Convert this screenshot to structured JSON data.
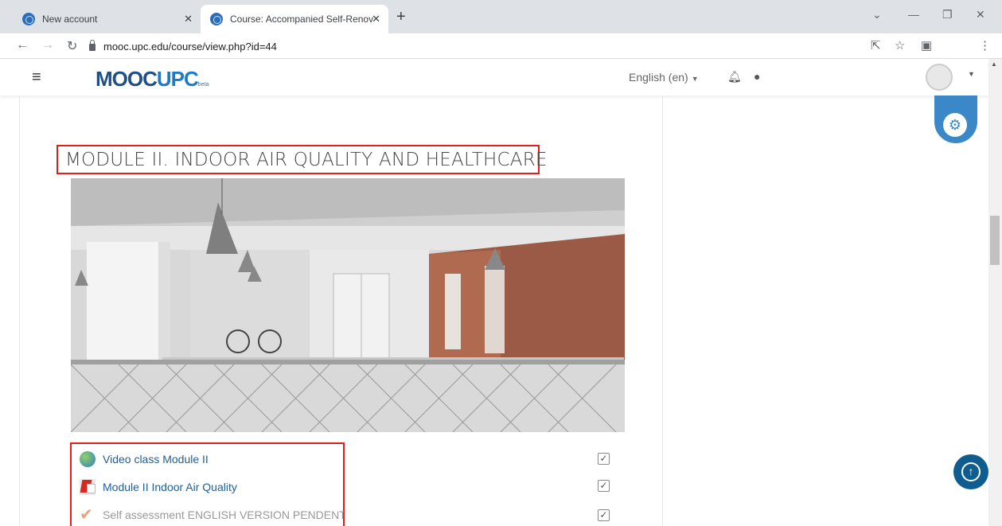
{
  "browser": {
    "tabs": [
      {
        "title": "New account"
      },
      {
        "title": "Course: Accompanied Self-Renov"
      }
    ],
    "url": "mooc.upc.edu/course/view.php?id=44"
  },
  "site": {
    "logo_main": "MOOC",
    "logo_accent": "UPC",
    "logo_beta": "beta",
    "language": "English (en)"
  },
  "module": {
    "title": "MODULE II. INDOOR AIR QUALITY AND HEALTHCARE",
    "activities": [
      {
        "label": "Video class Module II",
        "icon": "video-icon",
        "completed": true,
        "dimmed": false
      },
      {
        "label": "Module II Indoor Air Quality",
        "icon": "pdf-icon",
        "completed": true,
        "dimmed": false
      },
      {
        "label": "Self assessment ENGLISH VERSION PENDENT",
        "icon": "quiz-check-icon",
        "completed": true,
        "dimmed": true
      }
    ]
  },
  "colors": {
    "highlight_border": "#e0201a",
    "link": "#1f5f95",
    "accent_blue": "#3a88c8"
  }
}
